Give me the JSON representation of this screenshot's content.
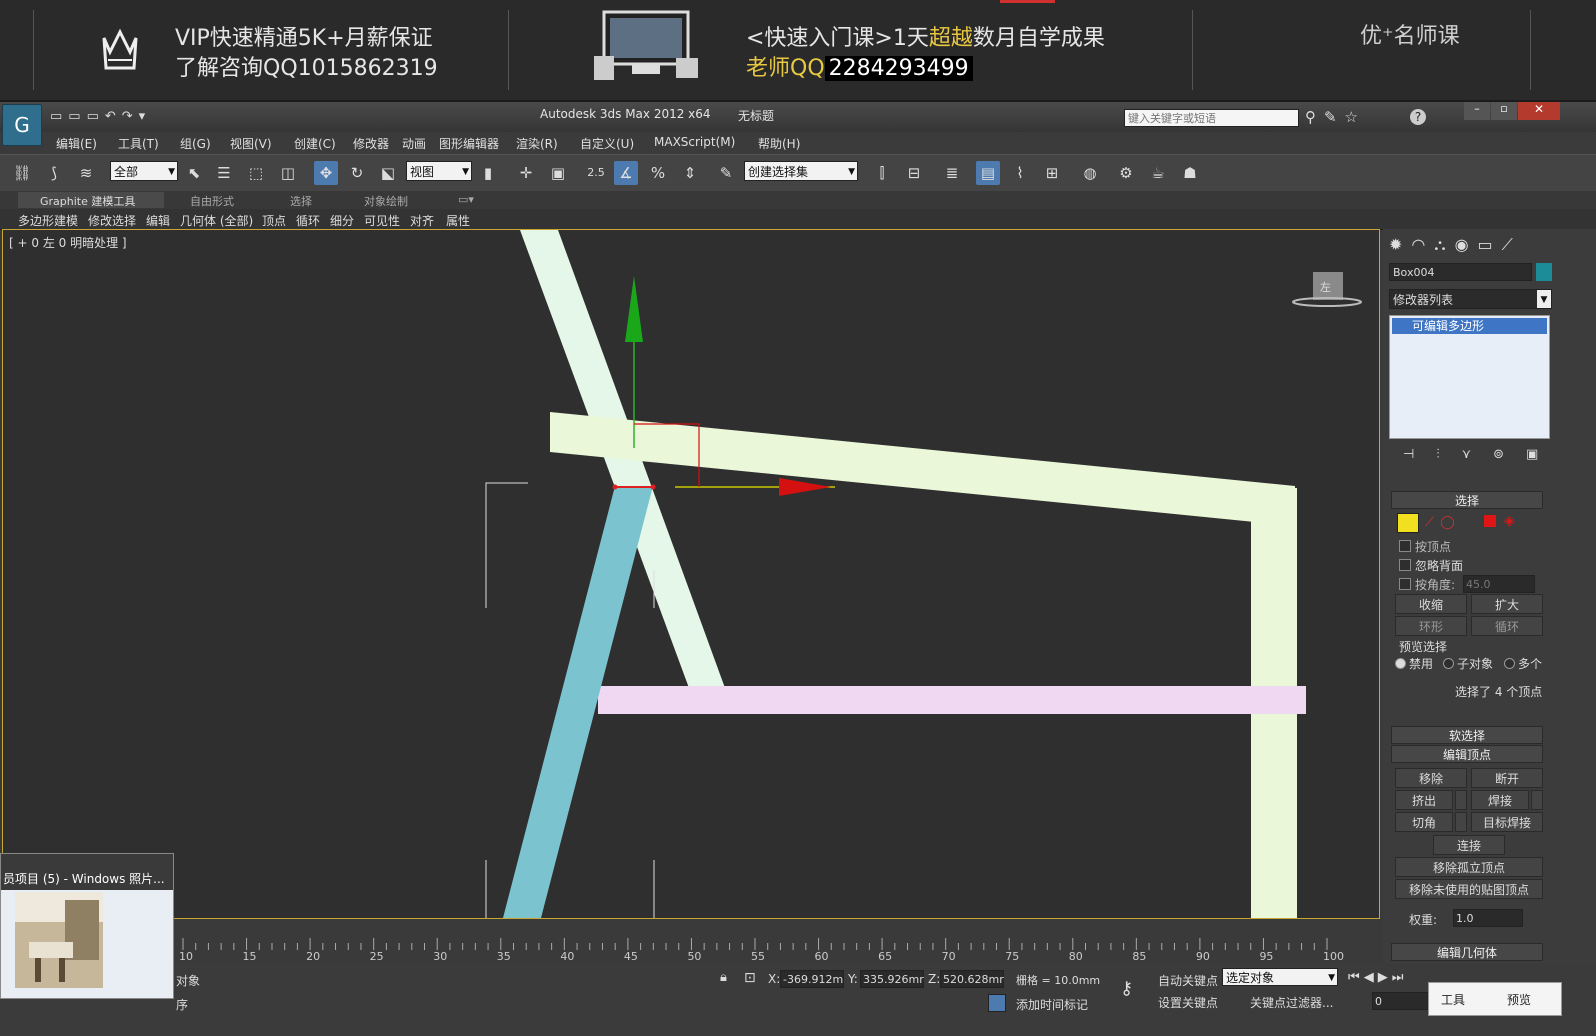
{
  "banner": {
    "left_line1": "VIP快速精通5K+月薪保证",
    "left_line2": "了解咨询QQ1015862319",
    "mid_line1_a": "<快速入门课>1天",
    "mid_line1_b": "超越",
    "mid_line1_c": "数月自学成果",
    "mid_line2_a": "老师QQ",
    "mid_line2_b": "2284293499",
    "right_logo": "优⁺名师课"
  },
  "titlebar": {
    "app_title": "Autodesk 3ds Max  2012 x64",
    "doc_title": "无标题",
    "search_placeholder": "键入关键字或短语",
    "help_label": "?"
  },
  "menu": [
    "编辑(E)",
    "工具(T)",
    "组(G)",
    "视图(V)",
    "创建(C)",
    "修改器",
    "动画",
    "图形编辑器",
    "渲染(R)",
    "自定义(U)",
    "MAXScript(M)",
    "帮助(H)"
  ],
  "toolbar": {
    "selection_filter": "全部",
    "ref_coord": "视图",
    "named_selection": "创建选择集",
    "snap_label": "2.5"
  },
  "ribbon": {
    "tabs": [
      "Graphite 建模工具",
      "自由形式",
      "选择",
      "对象绘制"
    ],
    "items": [
      "多边形建模",
      "修改选择",
      "编辑",
      "几何体 (全部)",
      "顶点",
      "循环",
      "细分",
      "可见性",
      "对齐",
      "属性"
    ]
  },
  "viewport": {
    "label": "[ + 0 左 0 明暗处理 ]",
    "viewcube_label": "左"
  },
  "cmdpanel": {
    "object_name": "Box004",
    "modifier_list": "修改器列表",
    "stack_item": "可编辑多边形",
    "selection_title": "选择",
    "by_vertex": "按顶点",
    "ignore_backfacing": "忽略背面",
    "by_angle": "按角度:",
    "angle_value": "45.0",
    "shrink": "收缩",
    "grow": "扩大",
    "ring": "环形",
    "loop": "循环",
    "preview_title": "预览选择",
    "disable": "禁用",
    "subobject": "子对象",
    "multi": "多个",
    "selected_info": "选择了 4 个顶点",
    "soft_selection": "软选择",
    "edit_vertices": "编辑顶点",
    "remove": "移除",
    "break": "断开",
    "extrude": "挤出",
    "weld": "焊接",
    "chamfer": "切角",
    "target_weld": "目标焊接",
    "connect": "连接",
    "remove_isolated": "移除孤立顶点",
    "remove_unused_map": "移除未使用的贴图顶点",
    "weight_label": "权重:",
    "weight_value": "1.0",
    "edit_geometry": "编辑几何体"
  },
  "timeline": {
    "ticks": [
      "10",
      "15",
      "20",
      "25",
      "30",
      "35",
      "40",
      "45",
      "50",
      "55",
      "60",
      "65",
      "70",
      "75",
      "80",
      "85",
      "90",
      "95",
      "100"
    ]
  },
  "status": {
    "object_label": "对象",
    "x_label": "X:",
    "x_value": "-369.912m",
    "y_label": "Y:",
    "y_value": "335.926mr",
    "z_label": "Z:",
    "z_value": "520.628mr",
    "grid": "栅格 = 10.0mm",
    "auto_key": "自动关键点",
    "set_key": "设置关键点",
    "selected_dropdown": "选定对象",
    "key_filters": "关键点过滤器...",
    "add_time_tag": "添加时间标记",
    "frame_value": "0",
    "tools": "工具",
    "preview": "预览",
    "bottom_left": "序"
  },
  "thumb": {
    "title": "员项目 (5) - Windows 照片..."
  },
  "colors": {
    "accent_blue": "#4d7bb0",
    "viewport_border": "#c9a630",
    "beam_green": "#eaf7d8",
    "beam_blue": "#7cc3d0",
    "beam_pink": "#f1d8f2"
  }
}
